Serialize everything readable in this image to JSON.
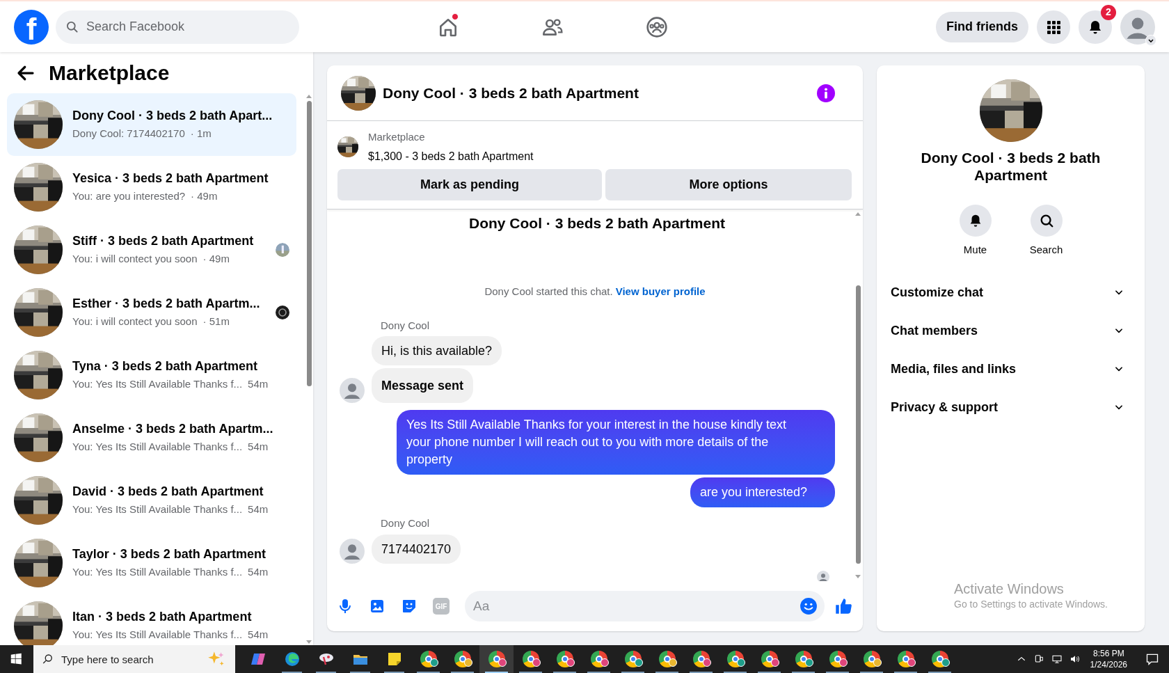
{
  "top_bar": {
    "logo": "f",
    "search": {
      "placeholder": "Search Facebook"
    },
    "nav": [
      {
        "kind": "home",
        "dot": true
      },
      {
        "kind": "friends",
        "dot": false
      },
      {
        "kind": "groups",
        "dot": false
      }
    ],
    "find_friends": "Find friends",
    "notifications_badge": "2"
  },
  "sidebar": {
    "title": "Marketplace",
    "conversations": [
      {
        "name": "Dony Cool · 3 beds 2 bath Apart...",
        "preview": "Dony Cool: 7174402170",
        "time": "· 1m",
        "selected": true
      },
      {
        "name": "Yesica · 3 beds 2 bath Apartment",
        "preview": "You: are you interested?",
        "time": "· 49m",
        "selected": false
      },
      {
        "name": "Stiff · 3 beds 2 bath Apartment",
        "preview": "You: i will contect you soon",
        "time": "· 49m",
        "selected": false,
        "kind": "seen_photo"
      },
      {
        "name": "Esther · 3 beds 2 bath Apartm...",
        "preview": "You: i will contect you soon",
        "time": "· 51m",
        "selected": false,
        "kind": "seen_dark"
      },
      {
        "name": "Tyna · 3 beds 2 bath Apartment",
        "preview": "You: Yes Its Still Available Thanks f...",
        "time": "54m",
        "selected": false
      },
      {
        "name": "Anselme · 3 beds 2 bath Apartm...",
        "preview": "You: Yes Its Still Available Thanks f...",
        "time": "54m",
        "selected": false
      },
      {
        "name": "David · 3 beds 2 bath Apartment",
        "preview": "You: Yes Its Still Available Thanks f...",
        "time": "54m",
        "selected": false
      },
      {
        "name": "Taylor · 3 beds 2 bath Apartment",
        "preview": "You: Yes Its Still Available Thanks f...",
        "time": "54m",
        "selected": false
      },
      {
        "name": "Itan · 3 beds 2 bath Apartment",
        "preview": "You: Yes Its Still Available Thanks f...",
        "time": "54m",
        "selected": false
      }
    ]
  },
  "chat": {
    "title": "Dony Cool · 3 beds 2 bath Apartment",
    "listing": {
      "source": "Marketplace",
      "summary": "$1,300 - 3 beds 2 bath Apartment",
      "buttons": [
        "Mark as pending",
        "More options"
      ]
    },
    "thread_title": "Dony Cool · 3 beds 2 bath Apartment",
    "started_note": "Dony Cool started this chat.",
    "buyer_link": "View buyer profile",
    "messages": [
      {
        "kind": "sender",
        "text": "Dony Cool"
      },
      {
        "kind": "incoming",
        "text": "Hi, is this available?",
        "avatar": false,
        "bold": false
      },
      {
        "kind": "incoming",
        "text": "Message sent",
        "avatar": true,
        "bold": true
      },
      {
        "kind": "outgoing",
        "text": "Yes Its Still Available Thanks for your interest in the house kindly text your phone number I will reach out to you with more details of the property"
      },
      {
        "kind": "outgoing",
        "text": "are you interested?"
      },
      {
        "kind": "sender",
        "text": "Dony Cool"
      },
      {
        "kind": "incoming",
        "text": "7174402170",
        "avatar": true,
        "bold": false
      }
    ],
    "composer": {
      "gif_label": "GIF",
      "placeholder": "Aa"
    }
  },
  "details": {
    "title": "Dony Cool · 3 beds 2 bath Apartment",
    "actions": [
      {
        "kind": "bell",
        "label": "Mute"
      },
      {
        "kind": "search",
        "label": "Search"
      }
    ],
    "sections": [
      {
        "label": "Customize chat",
        "expanded": false
      },
      {
        "label": "Chat members",
        "expanded": false
      },
      {
        "label": "Media, files and links",
        "expanded": false
      },
      {
        "label": "Privacy & support",
        "expanded": false
      }
    ]
  },
  "windows_notice": {
    "title": "Activate Windows",
    "subtitle": "Go to Settings to activate Windows."
  },
  "taskbar": {
    "search_placeholder": "Type here to search",
    "apps": [
      {
        "kind": "copilot",
        "selected": false
      },
      {
        "kind": "edge",
        "selected": false
      },
      {
        "kind": "paint",
        "selected": false
      },
      {
        "kind": "files",
        "selected": false
      },
      {
        "kind": "notes",
        "selected": false
      },
      {
        "kind": "chrome",
        "color": "#1e9e8a",
        "selected": false
      },
      {
        "kind": "chrome",
        "color": "#e9b730",
        "selected": false
      },
      {
        "kind": "chrome",
        "color": "#e0457b",
        "selected": true
      },
      {
        "kind": "chrome",
        "color": "#e0457b",
        "selected": false
      },
      {
        "kind": "chrome",
        "color": "#e0457b",
        "selected": false
      },
      {
        "kind": "chrome",
        "color": "#e0457b",
        "selected": false
      },
      {
        "kind": "chrome",
        "color": "#1e9e8a",
        "selected": false
      },
      {
        "kind": "chrome",
        "color": "#e9b730",
        "selected": false
      },
      {
        "kind": "chrome",
        "color": "#e0457b",
        "selected": false
      },
      {
        "kind": "chrome",
        "color": "#1e9e8a",
        "selected": false
      },
      {
        "kind": "chrome",
        "color": "#e0457b",
        "selected": false
      },
      {
        "kind": "chrome",
        "color": "#1e9e8a",
        "selected": false
      },
      {
        "kind": "chrome",
        "color": "#e0457b",
        "selected": false
      },
      {
        "kind": "chrome",
        "color": "#e9b730",
        "selected": false
      },
      {
        "kind": "chrome",
        "color": "#e0457b",
        "selected": false
      },
      {
        "kind": "chrome",
        "color": "#1e9e8a",
        "selected": false
      }
    ],
    "time": "8:56 PM",
    "date": "1/24/2026"
  }
}
